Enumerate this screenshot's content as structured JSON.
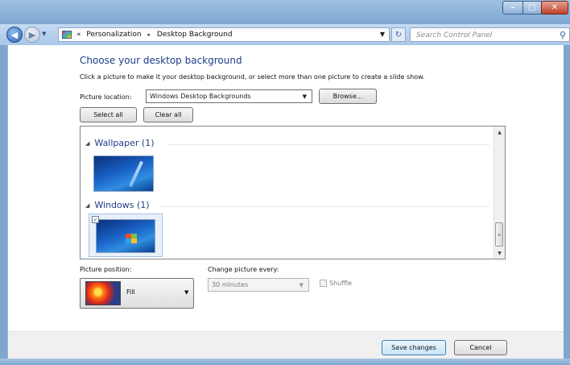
{
  "window": {
    "controls": {
      "minimize": "–",
      "maximize": "□",
      "close": "✕"
    }
  },
  "navigation": {
    "back_icon": "back-arrow-icon",
    "forward_icon": "forward-arrow-icon",
    "breadcrumb_prefix": "«",
    "breadcrumb": [
      "Personalization",
      "Desktop Background"
    ],
    "breadcrumb_separator": "▸",
    "refresh_icon": "refresh-icon",
    "search_placeholder": "Search Control Panel"
  },
  "page": {
    "heading": "Choose your desktop background",
    "instructions": "Click a picture to make it your desktop background, or select more than one picture to create a slide show.",
    "picture_location_label": "Picture location:",
    "picture_location_value": "Windows Desktop Backgrounds",
    "browse_label": "Browse...",
    "select_all_label": "Select all",
    "clear_all_label": "Clear all"
  },
  "gallery": {
    "groups": [
      {
        "title": "Wallpaper (1)",
        "items": [
          {
            "checked": false
          }
        ]
      },
      {
        "title": "Windows (1)",
        "items": [
          {
            "checked": true,
            "checkmark": "✓"
          }
        ]
      }
    ]
  },
  "options": {
    "picture_position_label": "Picture position:",
    "picture_position_value": "Fill",
    "change_picture_label": "Change picture every:",
    "change_picture_value": "30 minutes",
    "shuffle_label": "Shuffle"
  },
  "footer": {
    "save_label": "Save changes",
    "cancel_label": "Cancel"
  },
  "colors": {
    "heading": "#1e3d87",
    "frame": "#7fa6cf",
    "close_button": "#c0402a"
  }
}
